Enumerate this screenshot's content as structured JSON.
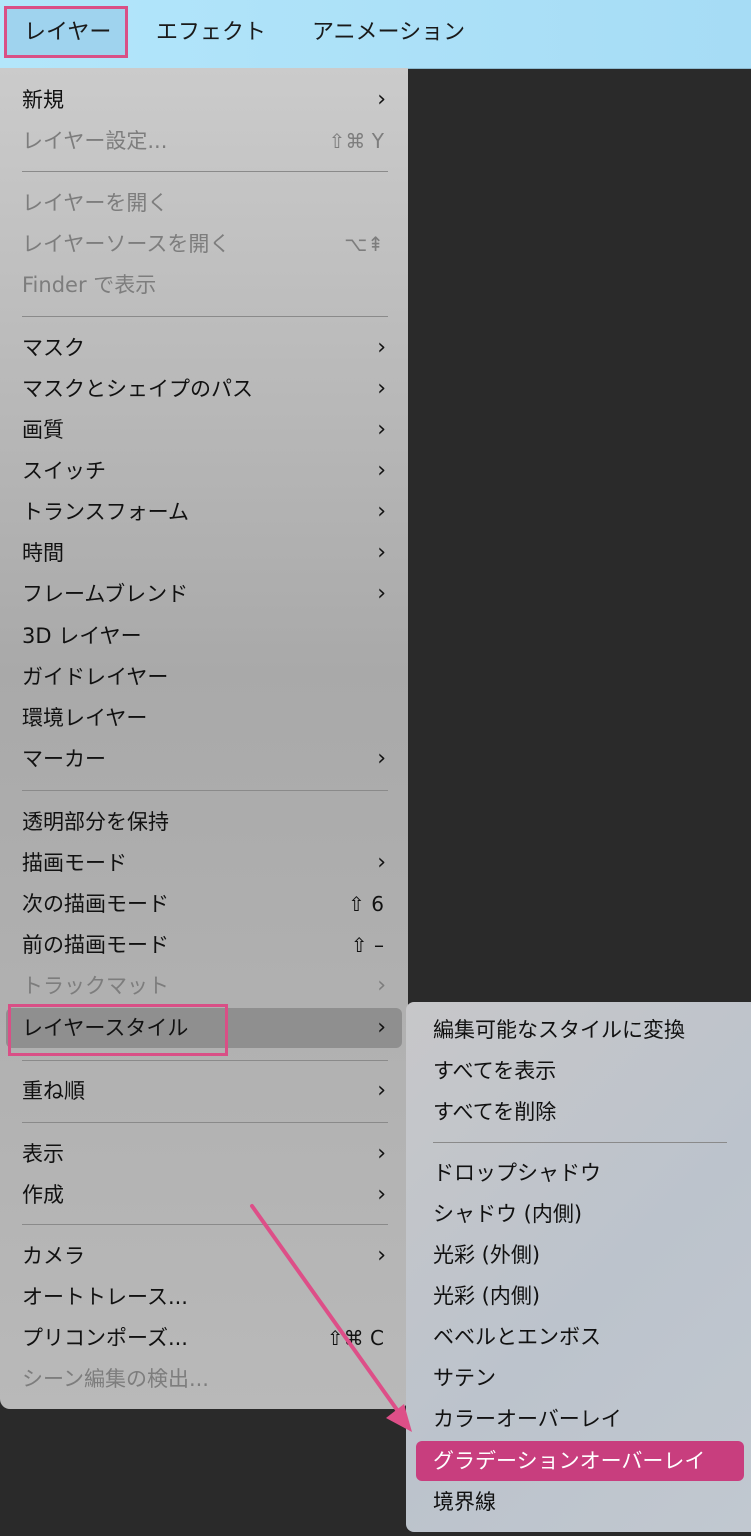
{
  "menubar": {
    "items": [
      {
        "label": "レイヤー"
      },
      {
        "label": "エフェクト"
      },
      {
        "label": "アニメーション"
      }
    ]
  },
  "layer_menu": {
    "items": [
      {
        "label": "新規",
        "arrow": "›",
        "shortcut": "",
        "disabled": false
      },
      {
        "label": "レイヤー設定...",
        "arrow": "",
        "shortcut": "⇧⌘ Y",
        "disabled": true
      },
      {
        "label": "レイヤーを開く",
        "arrow": "",
        "shortcut": "",
        "disabled": true
      },
      {
        "label": "レイヤーソースを開く",
        "arrow": "",
        "shortcut": "⌥⇞",
        "disabled": true
      },
      {
        "label": "Finder で表示",
        "arrow": "",
        "shortcut": "",
        "disabled": true
      },
      {
        "label": "マスク",
        "arrow": "›",
        "shortcut": "",
        "disabled": false
      },
      {
        "label": "マスクとシェイプのパス",
        "arrow": "›",
        "shortcut": "",
        "disabled": false
      },
      {
        "label": "画質",
        "arrow": "›",
        "shortcut": "",
        "disabled": false
      },
      {
        "label": "スイッチ",
        "arrow": "›",
        "shortcut": "",
        "disabled": false
      },
      {
        "label": "トランスフォーム",
        "arrow": "›",
        "shortcut": "",
        "disabled": false
      },
      {
        "label": "時間",
        "arrow": "›",
        "shortcut": "",
        "disabled": false
      },
      {
        "label": "フレームブレンド",
        "arrow": "›",
        "shortcut": "",
        "disabled": false
      },
      {
        "label": "3D レイヤー",
        "arrow": "",
        "shortcut": "",
        "disabled": false
      },
      {
        "label": "ガイドレイヤー",
        "arrow": "",
        "shortcut": "",
        "disabled": false
      },
      {
        "label": "環境レイヤー",
        "arrow": "",
        "shortcut": "",
        "disabled": false
      },
      {
        "label": "マーカー",
        "arrow": "›",
        "shortcut": "",
        "disabled": false
      },
      {
        "label": "透明部分を保持",
        "arrow": "",
        "shortcut": "",
        "disabled": false
      },
      {
        "label": "描画モード",
        "arrow": "›",
        "shortcut": "",
        "disabled": false
      },
      {
        "label": "次の描画モード",
        "arrow": "",
        "shortcut": "⇧ 6",
        "disabled": false
      },
      {
        "label": "前の描画モード",
        "arrow": "",
        "shortcut": "⇧ –",
        "disabled": false
      },
      {
        "label": "トラックマット",
        "arrow": "›",
        "shortcut": "",
        "disabled": true
      },
      {
        "label": "レイヤースタイル",
        "arrow": "›",
        "shortcut": "",
        "disabled": false,
        "highlighted": true
      },
      {
        "label": "重ね順",
        "arrow": "›",
        "shortcut": "",
        "disabled": false
      },
      {
        "label": "表示",
        "arrow": "›",
        "shortcut": "",
        "disabled": false
      },
      {
        "label": "作成",
        "arrow": "›",
        "shortcut": "",
        "disabled": false
      },
      {
        "label": "カメラ",
        "arrow": "›",
        "shortcut": "",
        "disabled": false
      },
      {
        "label": "オートトレース...",
        "arrow": "",
        "shortcut": "",
        "disabled": false
      },
      {
        "label": "プリコンポーズ...",
        "arrow": "",
        "shortcut": "⇧⌘ C",
        "disabled": false
      },
      {
        "label": "シーン編集の検出...",
        "arrow": "",
        "shortcut": "",
        "disabled": true
      }
    ]
  },
  "layer_style_submenu": {
    "items": [
      {
        "label": "編集可能なスタイルに変換"
      },
      {
        "label": "すべてを表示"
      },
      {
        "label": "すべてを削除"
      },
      {
        "label": "ドロップシャドウ"
      },
      {
        "label": "シャドウ (内側)"
      },
      {
        "label": "光彩 (外側)"
      },
      {
        "label": "光彩 (内側)"
      },
      {
        "label": "ベベルとエンボス"
      },
      {
        "label": "サテン"
      },
      {
        "label": "カラーオーバーレイ"
      },
      {
        "label": "グラデーションオーバーレイ",
        "selected": true
      },
      {
        "label": "境界線"
      }
    ]
  },
  "colors": {
    "highlight_pink": "#d94f86",
    "selected_item": "#c83e7e",
    "menubar_blue": "#a6dcf5"
  }
}
